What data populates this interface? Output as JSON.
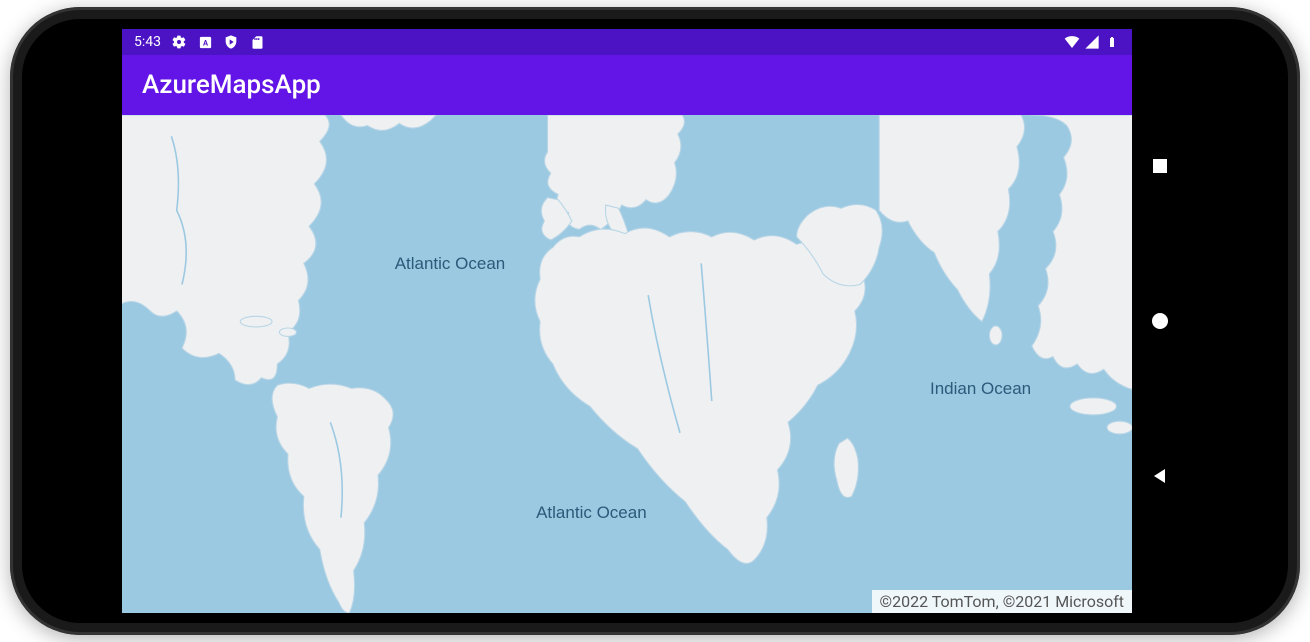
{
  "status_bar": {
    "time": "5:43"
  },
  "app_bar": {
    "title": "AzureMapsApp"
  },
  "map": {
    "labels": {
      "atlantic_north": "Atlantic Ocean",
      "atlantic_south": "Atlantic Ocean",
      "indian": "Indian Ocean"
    },
    "attribution": "©2022 TomTom, ©2021 Microsoft"
  },
  "colors": {
    "status_bar_bg": "#4b13c3",
    "app_bar_bg": "#6314e6",
    "ocean": "#9cc9e2",
    "land": "#eef0f2",
    "land_stroke": "#b7d5e6",
    "label": "#2b5a7a"
  }
}
